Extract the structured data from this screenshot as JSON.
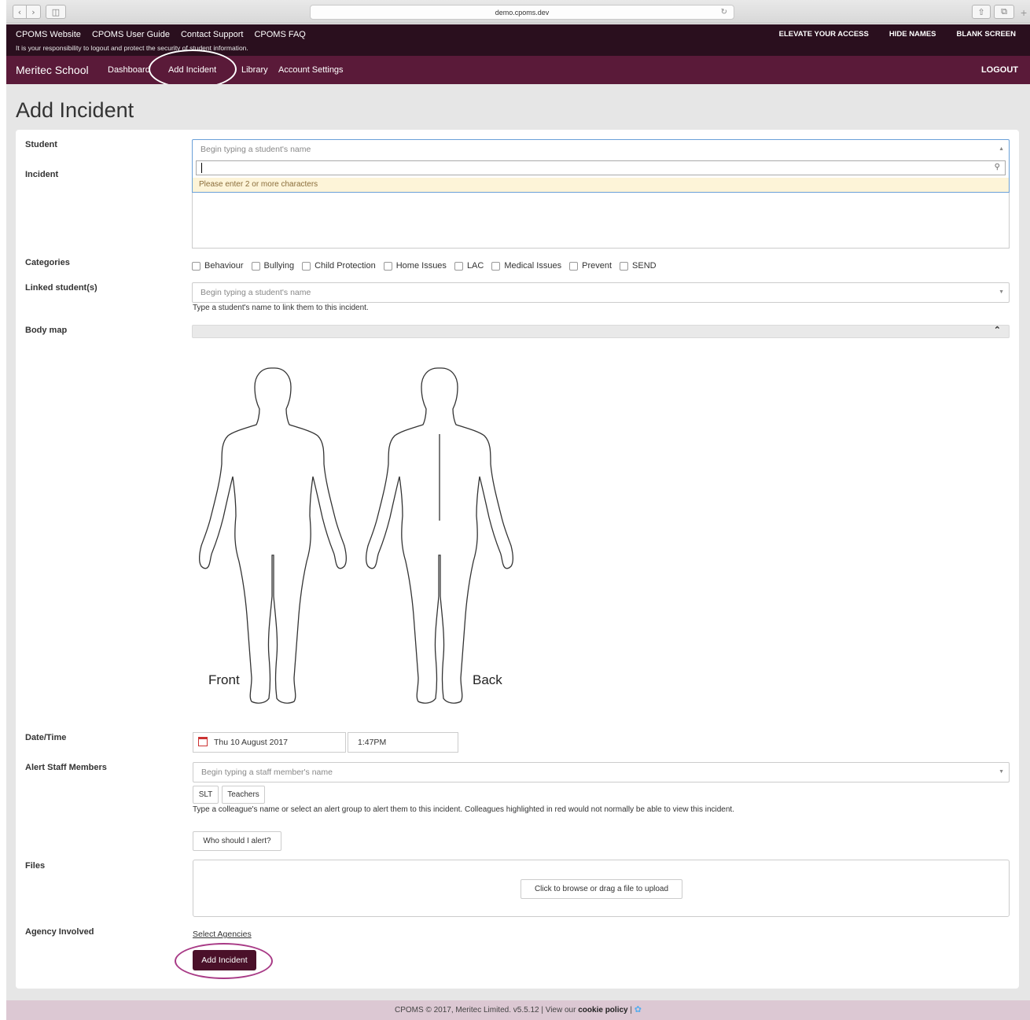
{
  "browser": {
    "url": "demo.cpoms.dev"
  },
  "topbar": {
    "links": [
      "CPOMS Website",
      "CPOMS User Guide",
      "Contact Support",
      "CPOMS FAQ"
    ],
    "notice": "It is your responsibility to logout and protect the security of student information.",
    "right": [
      "ELEVATE YOUR ACCESS",
      "HIDE NAMES",
      "BLANK SCREEN"
    ]
  },
  "navbar": {
    "brand": "Meritec School",
    "items": [
      "Dashboard",
      "Add Incident",
      "Library",
      "Account Settings"
    ],
    "logout": "LOGOUT",
    "active": "Add Incident"
  },
  "page": {
    "title": "Add Incident"
  },
  "form": {
    "student": {
      "label": "Student",
      "placeholder": "Begin typing a student's name",
      "dropdown_message": "Please enter 2 or more characters"
    },
    "incident": {
      "label": "Incident"
    },
    "categories": {
      "label": "Categories",
      "options": [
        "Behaviour",
        "Bullying",
        "Child Protection",
        "Home Issues",
        "LAC",
        "Medical Issues",
        "Prevent",
        "SEND"
      ]
    },
    "linked": {
      "label": "Linked student(s)",
      "placeholder": "Begin typing a student's name",
      "help": "Type a student's name to link them to this incident."
    },
    "bodymap": {
      "label": "Body map",
      "front": "Front",
      "back": "Back"
    },
    "datetime": {
      "label": "Date/Time",
      "date": "Thu 10 August 2017",
      "time": "1:47PM"
    },
    "alert": {
      "label": "Alert Staff Members",
      "placeholder": "Begin typing a staff member's name",
      "groups": [
        "SLT",
        "Teachers"
      ],
      "help": "Type a colleague's name or select an alert group to alert them to this incident. Colleagues highlighted in red would not normally be able to view this incident.",
      "who_button": "Who should I alert?"
    },
    "files": {
      "label": "Files",
      "upload_button": "Click to browse or drag a file to upload"
    },
    "agency": {
      "label": "Agency Involved",
      "link": "Select Agencies"
    },
    "submit": "Add Incident"
  },
  "footer": {
    "text": "CPOMS © 2017, Meritec Limited. v5.5.12 | View our",
    "cookie": "cookie policy",
    "sep": "|"
  },
  "colors": {
    "topbar": "#2a0f1e",
    "navbar": "#5a1a39",
    "submit": "#4a1029",
    "footer": "#dcc8d3",
    "annotation_circle": "#a83a86"
  },
  "icons": [
    "back-icon",
    "forward-icon",
    "sidebar-icon",
    "reload-icon",
    "share-icon",
    "tabs-icon",
    "search-icon",
    "calendar-icon",
    "chevron-up-icon",
    "twitter-icon"
  ]
}
